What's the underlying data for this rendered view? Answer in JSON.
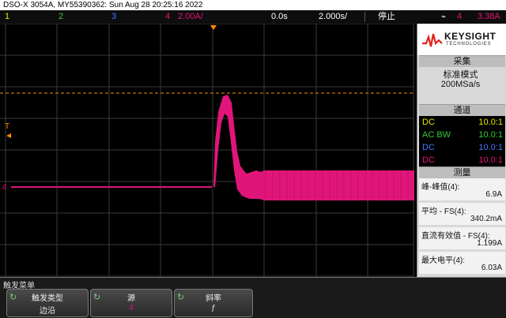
{
  "title": "DSO-X 3054A, MY55390362: Sun Aug 28 20:25:16 2022",
  "status": {
    "ch1": "1",
    "ch2": "2",
    "ch3": "3",
    "ch4": "4",
    "ch4_scale": "2.00A/",
    "delay": "0.0s",
    "timebase": "2.000s/",
    "run_state": "停止",
    "trigger_ch": "4",
    "trigger_level": "3.38A",
    "trigger_icon": "trigger-edge-icon"
  },
  "panel": {
    "logo_brand": "KEYSIGHT",
    "logo_sub": "TECHNOLOGIES",
    "acq_title": "采集",
    "acq_mode": "标准模式",
    "acq_rate": "200MSa/s",
    "ch_title": "通道",
    "channels": [
      {
        "coupling": "DC",
        "probe": "10.0:1",
        "color": "#e8e800"
      },
      {
        "coupling": "AC BW",
        "probe": "10.0:1",
        "color": "#33cc33"
      },
      {
        "coupling": "DC",
        "probe": "10.0:1",
        "color": "#4477ff"
      },
      {
        "coupling": "DC",
        "probe": "10.0:1",
        "color": "#e0157a"
      }
    ],
    "meas_title": "测量",
    "measurements": [
      {
        "name": "峰-峰值(4):",
        "value": "6.9A"
      },
      {
        "name": "平均 - FS(4):",
        "value": "340.2mA"
      },
      {
        "name": "直流有效值 - FS(4):",
        "value": "1.199A"
      },
      {
        "name": "最大电平(4):",
        "value": "6.03A"
      }
    ]
  },
  "menu": {
    "title": "触发菜单",
    "softkeys": [
      {
        "label": "触发类型",
        "value": "边沿"
      },
      {
        "label": "源",
        "value": "4"
      },
      {
        "label": "斜率",
        "value": "ƒ"
      }
    ]
  },
  "colors": {
    "ch1": "#e8e800",
    "ch2": "#33cc33",
    "ch3": "#4477ff",
    "ch4": "#e0157a",
    "trigger_level_line": "#ff8c00",
    "grid": "#404040"
  },
  "waveform": {
    "channel": "4",
    "baseline_level_a": 0.0,
    "peak_a": 6.03,
    "peak_to_peak_a": 6.9,
    "settled_level_a": 1.2
  }
}
